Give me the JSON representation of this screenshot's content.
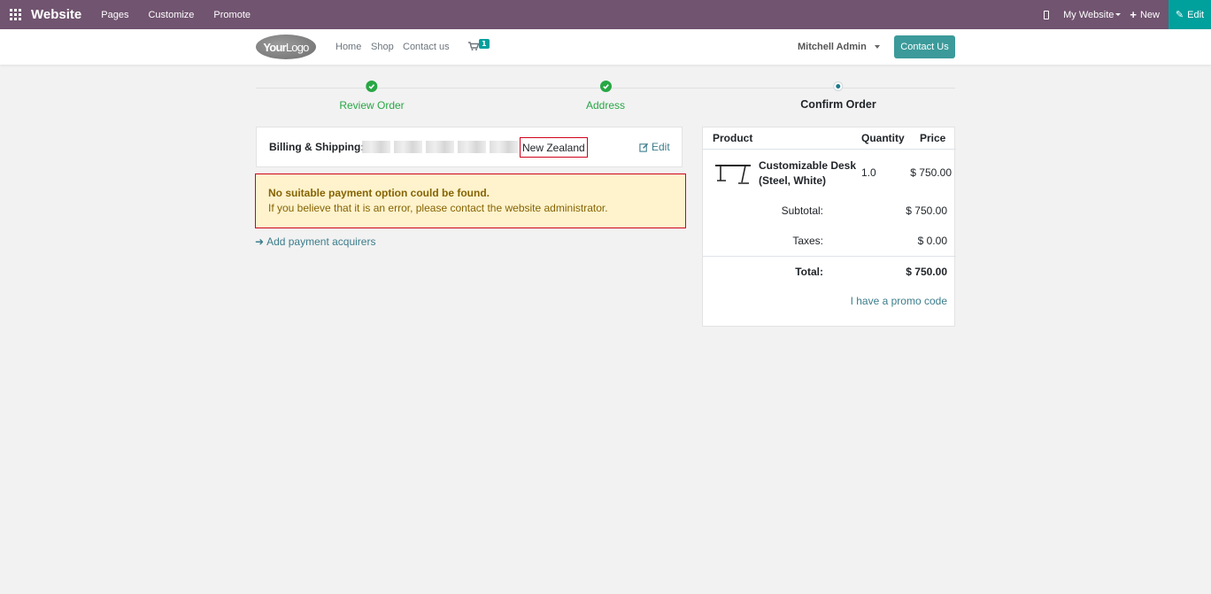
{
  "topbar": {
    "app_name": "Website",
    "menu": [
      "Pages",
      "Customize",
      "Promote"
    ],
    "site_selector": "My Website",
    "new_label": "New",
    "edit_label": "Edit"
  },
  "header": {
    "logo_text_bold": "Your",
    "logo_text_thin": "Logo",
    "nav": [
      "Home",
      "Shop",
      "Contact us"
    ],
    "cart_count": "1",
    "user": "Mitchell Admin",
    "contact_button": "Contact Us"
  },
  "wizard": {
    "steps": [
      {
        "label": "Review Order",
        "state": "done"
      },
      {
        "label": "Address",
        "state": "done"
      },
      {
        "label": "Confirm Order",
        "state": "current"
      }
    ]
  },
  "billing": {
    "label": "Billing & Shipping:",
    "country": "New Zealand",
    "edit_label": "Edit"
  },
  "alert": {
    "title": "No suitable payment option could be found.",
    "text": "If you believe that it is an error, please contact the website administrator."
  },
  "add_acquirers": "Add payment acquirers",
  "summary": {
    "headers": {
      "product": "Product",
      "quantity": "Quantity",
      "price": "Price"
    },
    "item": {
      "name": "Customizable Desk (Steel, White)",
      "quantity": "1.0",
      "price": "$ 750.00"
    },
    "subtotal_label": "Subtotal:",
    "subtotal": "$ 750.00",
    "taxes_label": "Taxes:",
    "taxes": "$ 0.00",
    "total_label": "Total:",
    "total": "$ 750.00",
    "promo": "I have a promo code"
  },
  "colors": {
    "topbar": "#715470",
    "accent": "#00a09d",
    "success": "#28a745",
    "alert_bg": "#fff3cd",
    "highlight_border": "#d0021b"
  }
}
